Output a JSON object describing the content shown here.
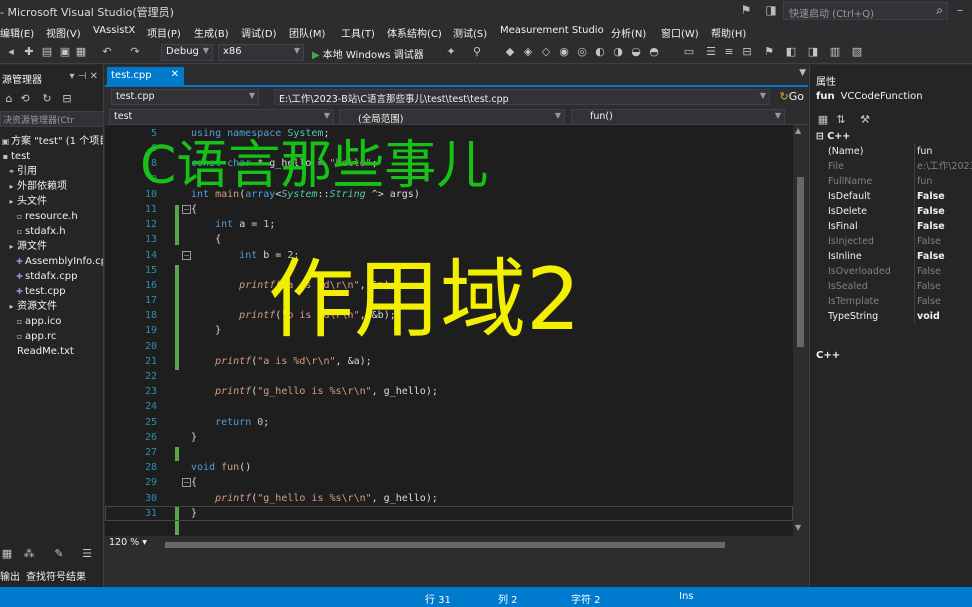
{
  "window": {
    "title": "- Microsoft Visual Studio(管理员)"
  },
  "quick_launch": {
    "placeholder": "快速启动 (Ctrl+Q)"
  },
  "menu": [
    "编辑(E)",
    "视图(V)",
    "VAssistX",
    "项目(P)",
    "生成(B)",
    "调试(D)",
    "团队(M)",
    "工具(T)",
    "体系结构(C)",
    "测试(S)",
    "Measurement Studio",
    "分析(N)",
    "窗口(W)",
    "帮助(H)"
  ],
  "toolbar": {
    "config": "Debug",
    "platform": "x86",
    "start_label": "本地 Windows 调试器"
  },
  "solution_explorer": {
    "title": "源管理器",
    "search_placeholder": "决资源管理器(Ctr",
    "items": [
      {
        "icon": "solution-icon",
        "label": "方案 \"test\" (1 个项目)"
      },
      {
        "icon": "project-icon",
        "label": "test"
      },
      {
        "icon": "references-icon",
        "label": "引用"
      },
      {
        "icon": "folder-icon",
        "label": "外部依赖项"
      },
      {
        "icon": "folder-icon",
        "label": "头文件"
      },
      {
        "icon": "header-file-icon",
        "label": "resource.h"
      },
      {
        "icon": "header-file-icon",
        "label": "stdafx.h"
      },
      {
        "icon": "folder-icon",
        "label": "源文件"
      },
      {
        "icon": "cpp-file-icon",
        "label": "AssemblyInfo.cpp"
      },
      {
        "icon": "cpp-file-icon",
        "label": "stdafx.cpp"
      },
      {
        "icon": "cpp-file-icon",
        "label": "test.cpp"
      },
      {
        "icon": "folder-icon",
        "label": "资源文件"
      },
      {
        "icon": "ico-file-icon",
        "label": "app.ico"
      },
      {
        "icon": "rc-file-icon",
        "label": "app.rc"
      },
      {
        "icon": "text-file-icon",
        "label": "ReadMe.txt"
      }
    ],
    "bottom_tabs": [
      "输出",
      "查找符号结果"
    ]
  },
  "editor": {
    "tab": "test.cpp",
    "file_combo": "test.cpp",
    "path": "E:\\工作\\2023-B站\\C语言那些事儿\\test\\test\\test.cpp",
    "go": "Go",
    "scope_project": "test",
    "scope_global": "(全局范围)",
    "scope_function": "fun()",
    "zoom": "120 %",
    "lines": [
      {
        "n": "5",
        "code": [
          [
            "kw",
            "using namespace "
          ],
          [
            "ty",
            "System"
          ],
          [
            "plain",
            ";"
          ]
        ]
      },
      {
        "n": "6",
        "code": []
      },
      {
        "n": "8",
        "code": [
          [
            "kw",
            "const char "
          ],
          [
            "plain",
            "* g_hello = "
          ],
          [
            "str",
            "\"hello\""
          ],
          [
            "plain",
            ";"
          ]
        ]
      },
      {
        "n": "9",
        "code": []
      },
      {
        "n": "10",
        "code": [
          [
            "kw",
            "int "
          ],
          [
            "fn",
            "main"
          ],
          [
            "plain",
            "("
          ],
          [
            "kw",
            "array"
          ],
          [
            "plain",
            "<"
          ],
          [
            "ty ital",
            "System"
          ],
          [
            "plain",
            "::"
          ],
          [
            "ty ital",
            "String"
          ],
          [
            "plain",
            " ^> args)"
          ]
        ]
      },
      {
        "n": "11",
        "code": [
          [
            "plain",
            "{"
          ]
        ]
      },
      {
        "n": "12",
        "code": [
          [
            "plain",
            "    "
          ],
          [
            "kw",
            "int "
          ],
          [
            "plain",
            "a = "
          ],
          [
            "num",
            "1"
          ],
          [
            "plain",
            ";"
          ]
        ]
      },
      {
        "n": "13",
        "code": [
          [
            "plain",
            "    {"
          ]
        ]
      },
      {
        "n": "14",
        "code": [
          [
            "plain",
            "        "
          ],
          [
            "kw",
            "int "
          ],
          [
            "plain",
            "b = "
          ],
          [
            "num",
            "2"
          ],
          [
            "plain",
            ";"
          ]
        ]
      },
      {
        "n": "15",
        "code": []
      },
      {
        "n": "16",
        "code": [
          [
            "plain",
            "        "
          ],
          [
            "fn ital",
            "printf"
          ],
          [
            "plain",
            "("
          ],
          [
            "str",
            "\"a is %d\\r\\n\""
          ],
          [
            "plain",
            ", &a);"
          ]
        ]
      },
      {
        "n": "17",
        "code": []
      },
      {
        "n": "18",
        "code": [
          [
            "plain",
            "        "
          ],
          [
            "fn ital",
            "printf"
          ],
          [
            "plain",
            "("
          ],
          [
            "str",
            "\"b is %d\\r\\n\""
          ],
          [
            "plain",
            ", &b);"
          ]
        ]
      },
      {
        "n": "19",
        "code": [
          [
            "plain",
            "    }"
          ]
        ]
      },
      {
        "n": "20",
        "code": []
      },
      {
        "n": "21",
        "code": [
          [
            "plain",
            "    "
          ],
          [
            "fn ital",
            "printf"
          ],
          [
            "plain",
            "("
          ],
          [
            "str",
            "\"a is %d\\r\\n\""
          ],
          [
            "plain",
            ", &a);"
          ]
        ]
      },
      {
        "n": "22",
        "code": []
      },
      {
        "n": "23",
        "code": [
          [
            "plain",
            "    "
          ],
          [
            "fn ital",
            "printf"
          ],
          [
            "plain",
            "("
          ],
          [
            "str",
            "\"g_hello is %s\\r\\n\""
          ],
          [
            "plain",
            ", g_hello);"
          ]
        ]
      },
      {
        "n": "24",
        "code": []
      },
      {
        "n": "25",
        "code": [
          [
            "plain",
            "    "
          ],
          [
            "kw",
            "return "
          ],
          [
            "num",
            "0"
          ],
          [
            "plain",
            ";"
          ]
        ]
      },
      {
        "n": "26",
        "code": [
          [
            "plain",
            "}"
          ]
        ]
      },
      {
        "n": "27",
        "code": []
      },
      {
        "n": "28",
        "code": [
          [
            "kw",
            "void "
          ],
          [
            "fn",
            "fun"
          ],
          [
            "plain",
            "()"
          ]
        ]
      },
      {
        "n": "29",
        "code": [
          [
            "plain",
            "{"
          ]
        ]
      },
      {
        "n": "30",
        "code": [
          [
            "plain",
            "    "
          ],
          [
            "fn ital",
            "printf"
          ],
          [
            "plain",
            "("
          ],
          [
            "str",
            "\"g_hello is %s\\r\\n\""
          ],
          [
            "plain",
            ", g_hello);"
          ]
        ]
      },
      {
        "n": "31",
        "code": [
          [
            "plain",
            "}"
          ]
        ]
      }
    ]
  },
  "overlay": {
    "title": "C语言那些事儿",
    "subtitle": "作用域2"
  },
  "properties": {
    "title": "属性",
    "object_name": "fun",
    "object_type": "VCCodeFunction",
    "category": "C++",
    "rows": [
      {
        "name": "(Name)",
        "value": "fun",
        "bold": false,
        "disabled": false
      },
      {
        "name": "File",
        "value": "e:\\工作\\2023",
        "bold": false,
        "disabled": true
      },
      {
        "name": "FullName",
        "value": "fun",
        "bold": false,
        "disabled": true
      },
      {
        "name": "IsDefault",
        "value": "False",
        "bold": true,
        "disabled": false
      },
      {
        "name": "IsDelete",
        "value": "False",
        "bold": true,
        "disabled": false
      },
      {
        "name": "IsFinal",
        "value": "False",
        "bold": true,
        "disabled": false
      },
      {
        "name": "IsInjected",
        "value": "False",
        "bold": false,
        "disabled": true
      },
      {
        "name": "IsInline",
        "value": "False",
        "bold": true,
        "disabled": false
      },
      {
        "name": "IsOverloaded",
        "value": "False",
        "bold": false,
        "disabled": true
      },
      {
        "name": "IsSealed",
        "value": "False",
        "bold": false,
        "disabled": true
      },
      {
        "name": "IsTemplate",
        "value": "False",
        "bold": false,
        "disabled": true
      },
      {
        "name": "TypeString",
        "value": "void",
        "bold": true,
        "disabled": false
      }
    ],
    "description": "C++"
  },
  "status": {
    "line": "行 31",
    "col": "列 2",
    "ch": "字符 2",
    "mode": "Ins"
  },
  "colors": {
    "accent": "#007acc",
    "overlay_title": "#16c216",
    "overlay_subtitle": "#f2f000",
    "change_bar": "#57a64a"
  }
}
